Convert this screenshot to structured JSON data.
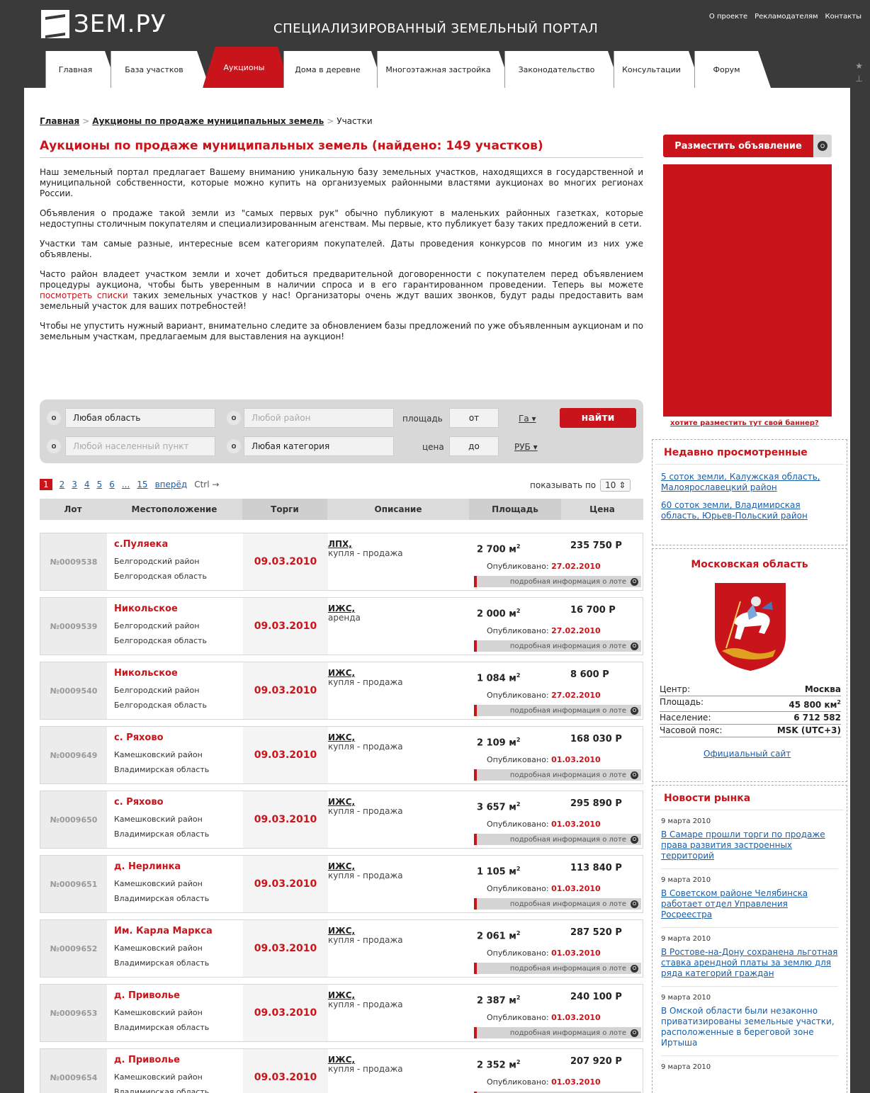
{
  "header": {
    "logo_text": "ЗЕМ.РУ",
    "tagline": "СПЕЦИАЛИЗИРОВАННЫЙ ЗЕМЕЛЬНЫЙ ПОРТАЛ",
    "toplinks": [
      "О проекте",
      "Рекламодателям",
      "Контакты"
    ]
  },
  "tabs": [
    "Главная",
    "База участков",
    "Аукционы",
    "Дома в деревне",
    "Многоэтажная застройка",
    "Законодательство",
    "Консультации",
    "Форум"
  ],
  "breadcrumb": {
    "home": "Главная",
    "auctions": "Аукционы по продаже муниципальных земель",
    "current": "Участки",
    "sep": ">"
  },
  "title": "Аукционы по продаже муниципальных земель (найдено: 149 участков)",
  "intro": {
    "p1": "Наш земельный портал предлагает Вашему вниманию уникальную базу земельных участков, находящихся в государственной и муниципальной собственности, которые можно купить на организуемых районными властями аукционах во многих регионах России.",
    "p2": "Объявления о продаже такой земли из \"самых первых рук\" обычно публикуют в маленьких районных газетках, которые недоступны столичным покупателям и специализированным агенствам. Мы первые, кто публикует базу таких предложений в сети.",
    "p3": "Участки там самые разные, интересные всем категориям покупателей. Даты проведения конкурсов по многим из них уже объявлены.",
    "p4_a": "Часто район владеет участком земли и хочет добиться предварительной договоренности с покупателем перед объявлением процедуры аукциона, чтобы быть уверенным в наличии спроса и в его гарантированном проведении. Теперь вы можете ",
    "p4_link": "посмотреть списки",
    "p4_b": " таких земельных участков у нас! Организаторы очень ждут ваших звонков, будут рады предоставить вам земельный участок для ваших потребностей!",
    "p5": "Чтобы не упустить нужный вариант, внимательно следите за обновлением базы предложений по уже объявленным аукционам и по земельным участкам, предлагаемым для выставления на аукцион!"
  },
  "filter": {
    "region": "Любая область",
    "district_ph": "Любой район",
    "locality_ph": "Любой населенный пункт",
    "category": "Любая категория",
    "area_label": "площадь",
    "price_label": "цена",
    "from": "от",
    "to": "до",
    "area_unit": "Га",
    "price_unit": "РУБ",
    "search": "найти",
    "circle": "O"
  },
  "pagination": {
    "pages": [
      "1",
      "2",
      "3",
      "4",
      "5",
      "6",
      "...",
      "15"
    ],
    "next": "вперёд",
    "ctrl": "Ctrl →",
    "show_by": "показывать по",
    "per_page": "10"
  },
  "table": {
    "headers": [
      "Лот",
      "Местоположение",
      "Торги",
      "Описание",
      "Площадь",
      "Цена"
    ],
    "pub_label": "Опубликовано:",
    "more_label": "подробная информация о лоте",
    "unit_m2": "м",
    "unit_sup": "2",
    "currency": "Р",
    "rows": [
      {
        "lot": "№0009538",
        "name": "с.Пуляека",
        "district": "Белгородский район",
        "region": "Белгородская область",
        "date": "09.03.2010",
        "type": "ЛПХ,",
        "deal": "купля - продажа",
        "area": "2 700",
        "price": "235 750",
        "pub": "27.02.2010"
      },
      {
        "lot": "№0009539",
        "name": "Никольское",
        "district": "Белгородский район",
        "region": "Белгородская область",
        "date": "09.03.2010",
        "type": "ИЖС,",
        "deal": "аренда",
        "area": "2 000",
        "price": "16 700",
        "pub": "27.02.2010"
      },
      {
        "lot": "№0009540",
        "name": "Никольское",
        "district": "Белгородский район",
        "region": "Белгородская область",
        "date": "09.03.2010",
        "type": "ИЖС,",
        "deal": "купля - продажа",
        "area": "1 084",
        "price": "8 600",
        "pub": "27.02.2010"
      },
      {
        "lot": "№0009649",
        "name": "с. Ряхово",
        "district": "Камешковский район",
        "region": "Владимирская область",
        "date": "09.03.2010",
        "type": "ИЖС,",
        "deal": "купля - продажа",
        "area": "2 109",
        "price": "168 030",
        "pub": "01.03.2010"
      },
      {
        "lot": "№0009650",
        "name": "с. Ряхово",
        "district": "Камешковский район",
        "region": "Владимирская область",
        "date": "09.03.2010",
        "type": "ИЖС,",
        "deal": "купля - продажа",
        "area": "3 657",
        "price": "295 890",
        "pub": "01.03.2010"
      },
      {
        "lot": "№0009651",
        "name": "д. Нерлинка",
        "district": "Камешковский район",
        "region": "Владимирская область",
        "date": "09.03.2010",
        "type": "ИЖС,",
        "deal": "купля - продажа",
        "area": "1 105",
        "price": "113 840",
        "pub": "01.03.2010"
      },
      {
        "lot": "№0009652",
        "name": "Им. Карла Маркса",
        "district": "Камешковский район",
        "region": "Владимирская область",
        "date": "09.03.2010",
        "type": "ИЖС,",
        "deal": "купля - продажа",
        "area": "2 061",
        "price": "287 520",
        "pub": "01.03.2010"
      },
      {
        "lot": "№0009653",
        "name": "д. Приволье",
        "district": "Камешковский район",
        "region": "Владимирская область",
        "date": "09.03.2010",
        "type": "ИЖС,",
        "deal": "купля - продажа",
        "area": "2 387",
        "price": "240 100",
        "pub": "01.03.2010"
      },
      {
        "lot": "№0009654",
        "name": "д. Приволье",
        "district": "Камешковский район",
        "region": "Владимирская область",
        "date": "09.03.2010",
        "type": "ИЖС,",
        "deal": "купля - продажа",
        "area": "2 352",
        "price": "207 920",
        "pub": "01.03.2010"
      }
    ]
  },
  "sidebar": {
    "post_ad": "Разместить объявление",
    "banner_link": "хотите разместить тут свой баннер?",
    "recent_title": "Недавно просмотренные",
    "recent": [
      "5 соток земли, Калужская область, Малоярославецкий район",
      "60 соток земли, Владимирская область, Юрьев-Польский район"
    ],
    "region_title": "Московская область",
    "stats": [
      {
        "label": "Центр:",
        "value": "Москва"
      },
      {
        "label": "Площадь:",
        "value": "45 800 км",
        "sup": "2"
      },
      {
        "label": "Население:",
        "value": "6 712 582"
      },
      {
        "label": "Часовой пояс:",
        "value": "MSK (UTC+3)"
      }
    ],
    "official": "Официальный сайт",
    "news_title": "Новости рынка",
    "news": [
      {
        "date": "9 марта 2010",
        "text": "В Самаре прошли торги по продаже права развития застроенных территорий"
      },
      {
        "date": "9 марта 2010",
        "text": "В Советском районе Челябинска работает отдел Управления Росреестра"
      },
      {
        "date": "9 марта 2010",
        "text": "В Ростове-на-Дону сохранена льготная ставка арендной платы за землю для ряда категорий граждан"
      },
      {
        "date": "9 марта 2010",
        "text": "В Омской области были незаконно приватизированы земельные участки, расположенные в береговой зоне Иртыша"
      },
      {
        "date": "9 марта 2010",
        "text": ""
      }
    ]
  },
  "colors": {
    "accent": "#c8141a",
    "link": "#1a5ea8",
    "header": "#3a3a3a"
  }
}
